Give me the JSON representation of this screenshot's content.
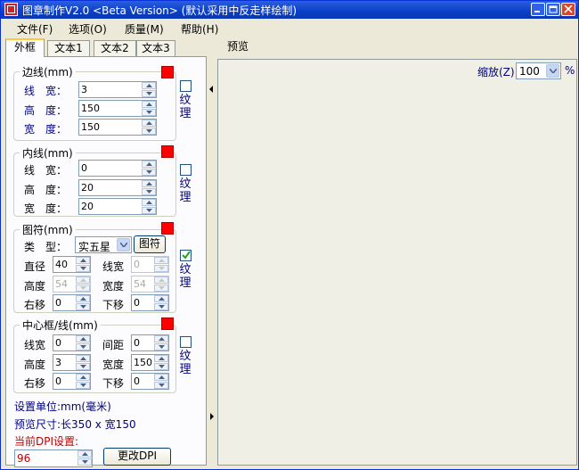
{
  "window": {
    "title": "图章制作V2.0 <Beta Version> (默认采用中反走样绘制)"
  },
  "menu": {
    "file": "文件(F)",
    "options": "选项(O)",
    "quality": "质量(M)",
    "help": "帮助(H)"
  },
  "tabs": {
    "outer": "外框",
    "text1": "文本1",
    "text2": "文本2",
    "text3": "文本3"
  },
  "border": {
    "legend": "边线(mm)",
    "line_label": "线　宽：",
    "line_value": "3",
    "height_label": "高　度：",
    "height_value": "150",
    "width_label": "宽　度：",
    "width_value": "150",
    "texture": "纹理",
    "texture_checked": false
  },
  "inner": {
    "legend": "内线(mm)",
    "line_label": "线　宽：",
    "line_value": "0",
    "height_label": "高　度：",
    "height_value": "20",
    "width_label": "宽　度：",
    "width_value": "20",
    "texture": "纹理",
    "texture_checked": false
  },
  "symbol": {
    "legend": "图符(mm)",
    "type_label": "类　型：",
    "type_value": "实五星",
    "button": "图符",
    "diameter_label": "直径",
    "diameter_value": "40",
    "line_label": "线宽",
    "line_value": "0",
    "height_label": "高度",
    "height_value": "54",
    "width_label": "宽度",
    "width_value": "54",
    "right_label": "右移",
    "right_value": "0",
    "down_label": "下移",
    "down_value": "0",
    "texture": "纹理",
    "texture_checked": true
  },
  "center": {
    "legend": "中心框/线(mm)",
    "line_label": "线宽",
    "line_value": "0",
    "gap_label": "间距",
    "gap_value": "0",
    "height_label": "高度",
    "height_value": "3",
    "width_label": "宽度",
    "width_value": "150",
    "right_label": "右移",
    "right_value": "0",
    "down_label": "下移",
    "down_value": "0",
    "texture": "纹理",
    "texture_checked": false
  },
  "info": {
    "unit": "设置单位:mm(毫米)",
    "size": "预览尺寸:长350 x 宽150",
    "dpi_label": "当前DPI设置:",
    "dpi_value": "96",
    "dpi_button": "更改DPI"
  },
  "preview": {
    "label": "预览",
    "zoom_label": "缩放(Z)",
    "zoom_value": "100",
    "percent": "%"
  },
  "colors": {
    "accent_red": "#ff0000",
    "label_blue": "#000080",
    "title_blue": "#0a3fc8"
  }
}
